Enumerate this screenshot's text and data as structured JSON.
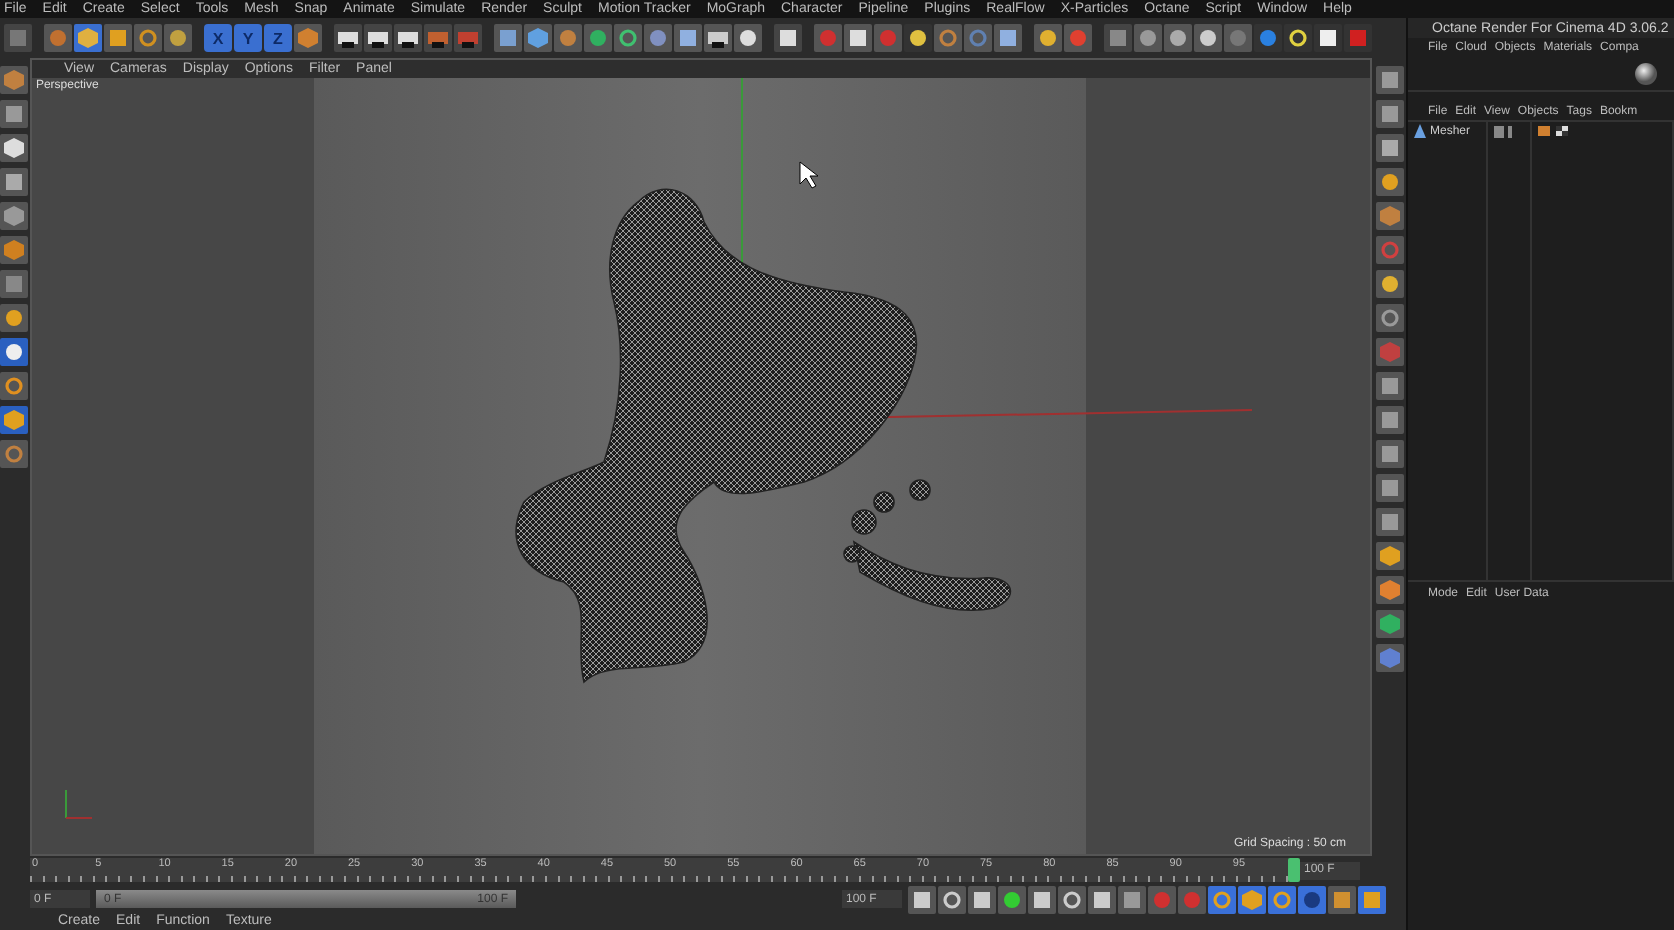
{
  "menu_bar": [
    "File",
    "Edit",
    "Create",
    "Select",
    "Tools",
    "Mesh",
    "Snap",
    "Animate",
    "Simulate",
    "Render",
    "Sculpt",
    "Motion Tracker",
    "MoGraph",
    "Character",
    "Pipeline",
    "Plugins",
    "RealFlow",
    "X-Particles",
    "Octane",
    "Script",
    "Window",
    "Help"
  ],
  "toolbar": {
    "axis_buttons": [
      "X",
      "Y",
      "Z"
    ]
  },
  "viewport": {
    "menu": [
      "View",
      "Cameras",
      "Display",
      "Options",
      "Filter",
      "Panel"
    ],
    "camera": "Perspective",
    "grid_spacing": "Grid Spacing : 50 cm"
  },
  "octane": {
    "title": "Octane Render For Cinema 4D 3.06.2",
    "menu": [
      "File",
      "Cloud",
      "Objects",
      "Materials",
      "Compa"
    ]
  },
  "objects": {
    "menu": [
      "File",
      "Edit",
      "View",
      "Objects",
      "Tags",
      "Bookm"
    ],
    "items": [
      {
        "name": "Mesher"
      }
    ]
  },
  "attributes": {
    "menu": [
      "Mode",
      "Edit",
      "User Data"
    ]
  },
  "timeline": {
    "ticks": [
      "0",
      "5",
      "10",
      "15",
      "20",
      "25",
      "30",
      "35",
      "40",
      "45",
      "50",
      "55",
      "60",
      "65",
      "70",
      "75",
      "80",
      "85",
      "90",
      "95"
    ],
    "end_field": "100 F"
  },
  "playback": {
    "current": "0 F",
    "range_slider": {
      "start": "0 F",
      "end": "100 F",
      "level": 1
    },
    "max": "100 F"
  },
  "bottom_menu": [
    "Create",
    "Edit",
    "Function",
    "Texture"
  ]
}
